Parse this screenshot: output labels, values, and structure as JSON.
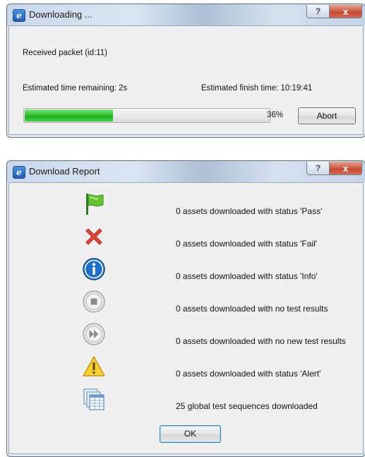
{
  "download_window": {
    "title": "Downloading ...",
    "help_glyph": "?",
    "close_glyph": "x",
    "status": "Received packet (id:11)",
    "time_remaining": "Estimated time remaining:  2s",
    "finish_time": "Estimated finish time:  10:19:41",
    "progress_fraction": 0.36,
    "progress_label": "36%",
    "abort_label": "Abort"
  },
  "report_window": {
    "title": "Download Report",
    "help_glyph": "?",
    "close_glyph": "x",
    "rows": [
      {
        "icon": "green-flag-icon",
        "text": "0 assets downloaded with status 'Pass'"
      },
      {
        "icon": "red-x-icon",
        "text": "0 assets downloaded with status 'Fail'"
      },
      {
        "icon": "info-icon",
        "text": "0 assets downloaded with status 'Info'"
      },
      {
        "icon": "stop-circle-icon",
        "text": "0 assets downloaded with no test results"
      },
      {
        "icon": "fast-forward-circle-icon",
        "text": "0 assets downloaded with no new test results"
      },
      {
        "icon": "warning-icon",
        "text": "0 assets downloaded with status 'Alert'"
      },
      {
        "icon": "test-sequences-icon",
        "text": "25 global test sequences downloaded"
      }
    ],
    "ok_label": "OK"
  }
}
